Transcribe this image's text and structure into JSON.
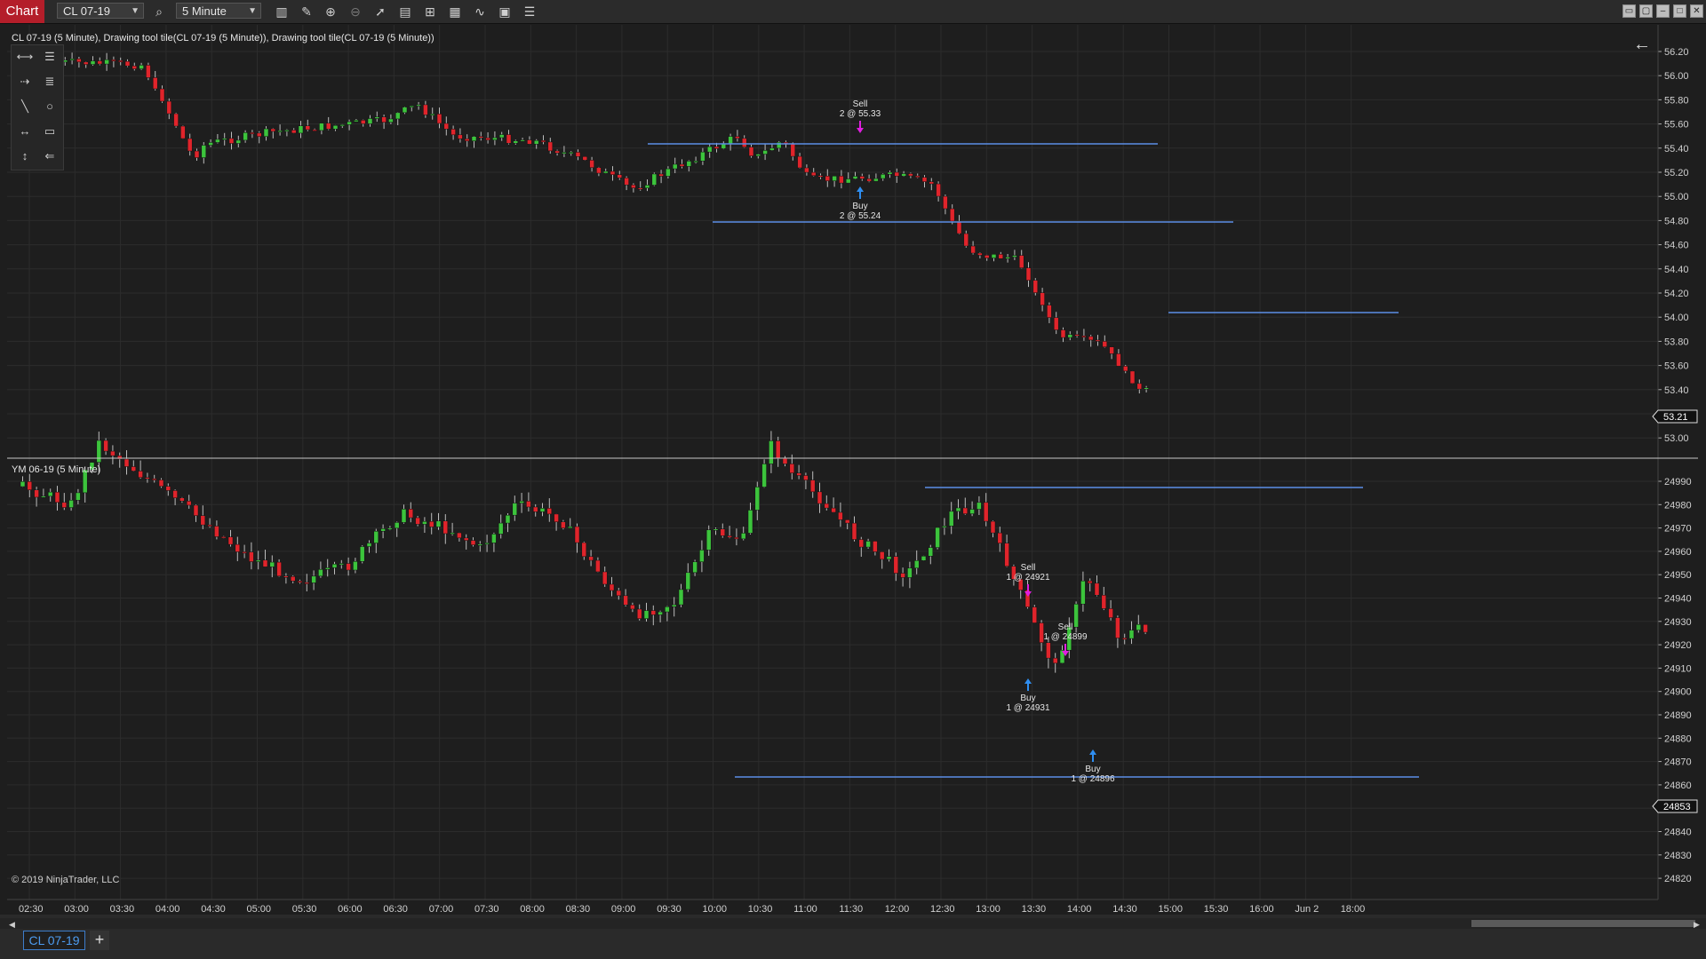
{
  "toolbar": {
    "chart_label": "Chart",
    "instrument": "CL 07-19",
    "interval": "5 Minute",
    "icons": [
      "bars-icon",
      "pencil-icon",
      "zoom-in-icon",
      "zoom-out-icon",
      "pointer-icon",
      "data-box-icon",
      "properties-icon",
      "templates-icon",
      "strategies-icon",
      "indicators-icon",
      "list-icon"
    ]
  },
  "panel_top": {
    "label": "CL 07-19 (5 Minute), Drawing tool tile(CL 07-19 (5 Minute)), Drawing tool tile(CL 07-19 (5 Minute))",
    "y_ticks": [
      "56.20",
      "56.00",
      "55.80",
      "55.60",
      "55.40",
      "55.20",
      "55.00",
      "54.80",
      "54.60",
      "54.40",
      "54.20",
      "54.00",
      "53.80",
      "53.60",
      "53.40",
      "53.20",
      "53.00"
    ],
    "last_price": "53.21",
    "trades": [
      {
        "side": "Sell",
        "label": "2 @ 55.33"
      },
      {
        "side": "Buy",
        "label": "2 @ 55.24"
      }
    ]
  },
  "panel_bottom": {
    "label": "YM 06-19 (5 Minute)",
    "y_ticks": [
      "24990",
      "24980",
      "24970",
      "24960",
      "24950",
      "24940",
      "24930",
      "24920",
      "24910",
      "24900",
      "24890",
      "24880",
      "24870",
      "24860",
      "24850",
      "24840",
      "24830",
      "24820"
    ],
    "last_price": "24853",
    "trades": [
      {
        "side": "Sell",
        "label": "1 @ 24921"
      },
      {
        "side": "Sell",
        "label": "1 @ 24899"
      },
      {
        "side": "Buy",
        "label": "1 @ 24931"
      },
      {
        "side": "Buy",
        "label": "1 @ 24896"
      }
    ],
    "copyright": "© 2019 NinjaTrader, LLC"
  },
  "x_axis": [
    "02:30",
    "03:00",
    "03:30",
    "04:00",
    "04:30",
    "05:00",
    "05:30",
    "06:00",
    "06:30",
    "07:00",
    "07:30",
    "08:00",
    "08:30",
    "09:00",
    "09:30",
    "10:00",
    "10:30",
    "11:00",
    "11:30",
    "12:00",
    "12:30",
    "13:00",
    "13:30",
    "14:00",
    "14:30",
    "15:00",
    "15:30",
    "16:00",
    "Jun 2",
    "18:00"
  ],
  "tabs": [
    {
      "label": "CL 07-19"
    }
  ],
  "colors": {
    "up": "#3cc43c",
    "down": "#e0242b",
    "line": "#5b8ee6",
    "sell_arrow": "#e01ee0",
    "buy_arrow": "#2f8ef0",
    "bg": "#1e1e1e",
    "grid": "#2c2c2c"
  }
}
